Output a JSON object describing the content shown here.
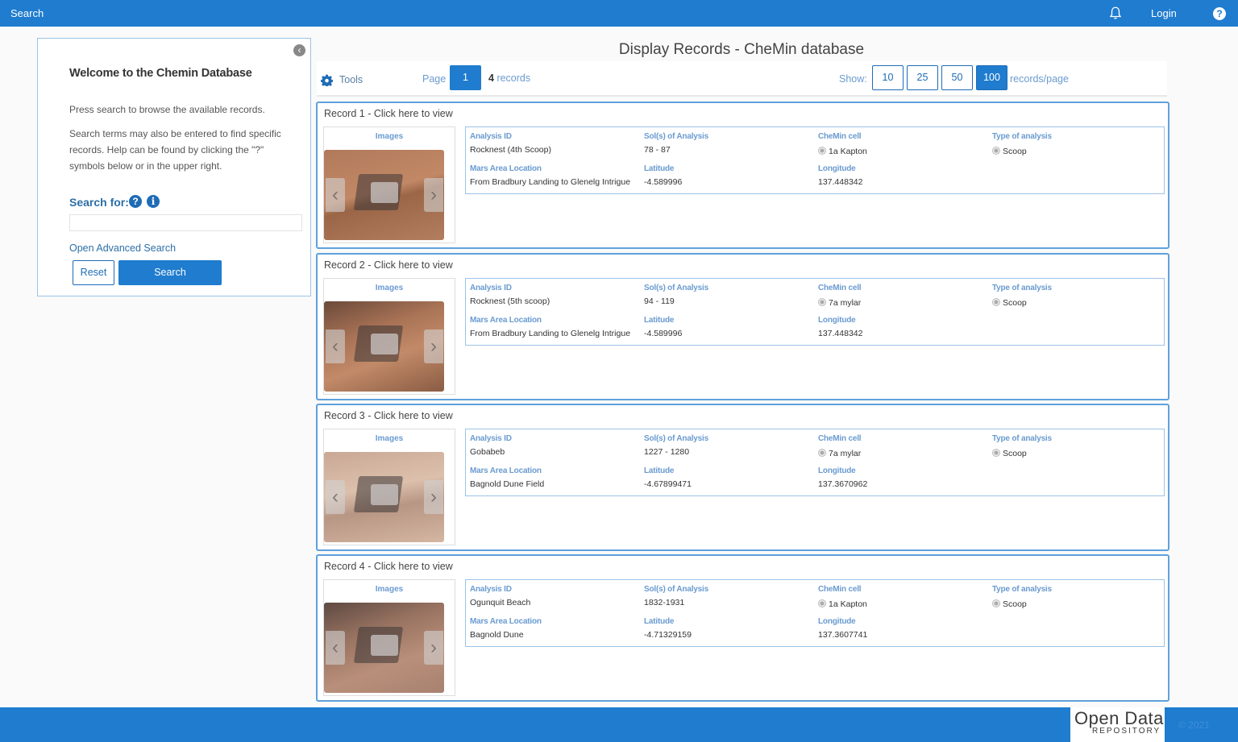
{
  "topbar": {
    "title": "Search",
    "login": "Login",
    "help": "?"
  },
  "left_panel": {
    "welcome": "Welcome to the Chemin Database",
    "intro1": "Press search to browse the available records.",
    "intro2": "Search terms may also be entered to find specific records. Help can be found by clicking the \"?\" symbols below or in the upper right.",
    "search_for": "Search for:",
    "search_value": "",
    "advanced_link": "Open Advanced Search",
    "reset_label": "Reset",
    "search_label": "Search"
  },
  "main": {
    "title": "Display Records - CheMin database",
    "tools_label": "Tools",
    "page_label": "Page",
    "current_page": "1",
    "record_count": "4",
    "records_label": "records",
    "show_label": "Show:",
    "page_sizes": [
      "10",
      "25",
      "50",
      "100"
    ],
    "active_page_size": "100",
    "per_page_label": "records/page"
  },
  "field_labels": {
    "images": "Images",
    "analysis_id": "Analysis ID",
    "sols": "Sol(s) of Analysis",
    "chemin_cell": "CheMin cell",
    "type": "Type of analysis",
    "location": "Mars Area Location",
    "latitude": "Latitude",
    "longitude": "Longitude"
  },
  "records": [
    {
      "header": "Record 1 - Click here to view",
      "analysis_id": "Rocknest (4th Scoop)",
      "sols": "78 - 87",
      "chemin_cell": "1a Kapton",
      "type": "Scoop",
      "location": "From Bradbury Landing to Glenelg Intrigue",
      "latitude": "-4.589996",
      "longitude": "137.448342"
    },
    {
      "header": "Record 2 - Click here to view",
      "analysis_id": "Rocknest (5th scoop)",
      "sols": "94 - 119",
      "chemin_cell": "7a mylar",
      "type": "Scoop",
      "location": "From Bradbury Landing to Glenelg Intrigue",
      "latitude": "-4.589996",
      "longitude": "137.448342"
    },
    {
      "header": "Record 3 - Click here to view",
      "analysis_id": "Gobabeb",
      "sols": "1227 - 1280",
      "chemin_cell": "7a mylar",
      "type": "Scoop",
      "location": "Bagnold Dune Field",
      "latitude": "-4.67899471",
      "longitude": "137.3670962"
    },
    {
      "header": "Record 4 - Click here to view",
      "analysis_id": "Ogunquit Beach",
      "sols": "1832-1931",
      "chemin_cell": "1a Kapton",
      "type": "Scoop",
      "location": "Bagnold Dune",
      "latitude": "-4.71329159",
      "longitude": "137.3607741"
    }
  ],
  "footer": {
    "logo_line1": "Open Data",
    "logo_line2": "REPOSITORY",
    "copyright": "© 2021"
  },
  "colors": {
    "primary": "#1f7ccf",
    "label": "#6a9bd0",
    "border": "#5fa1dc"
  }
}
